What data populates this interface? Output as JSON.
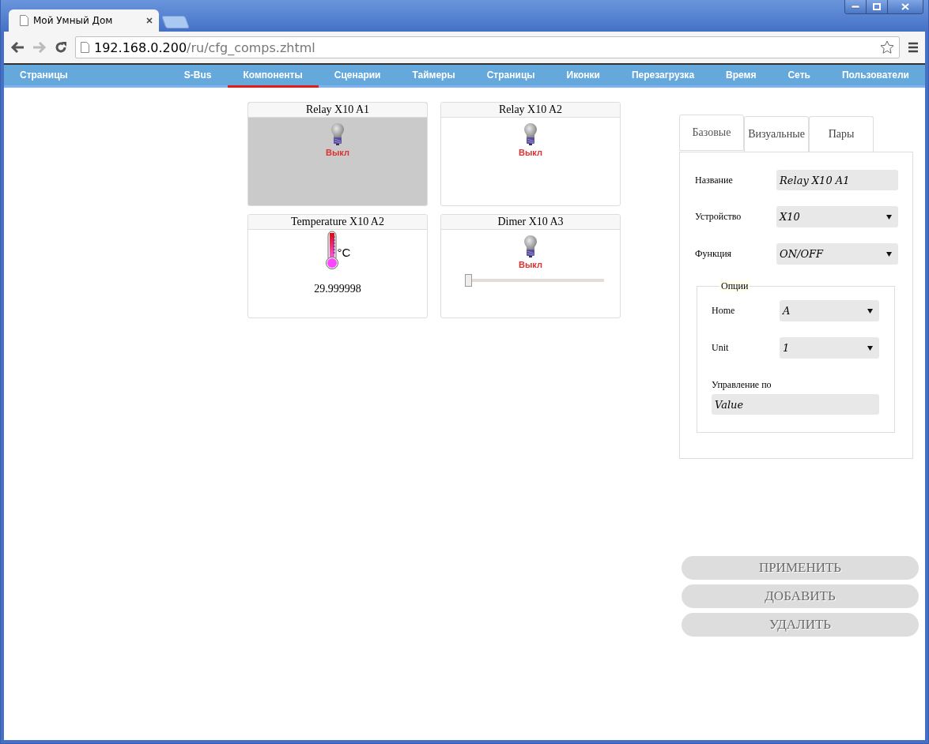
{
  "browser": {
    "tab_title": "Мой Умный Дом",
    "url_host": "192.168.0.200",
    "url_path": "/ru/cfg_comps.zhtml"
  },
  "nav": {
    "items": [
      {
        "label": "Страницы",
        "selected": false
      },
      {
        "label": "S-Bus",
        "selected": false
      },
      {
        "label": "Компоненты",
        "selected": true
      },
      {
        "label": "Сценарии",
        "selected": false
      },
      {
        "label": "Таймеры",
        "selected": false
      },
      {
        "label": "Страницы",
        "selected": false
      },
      {
        "label": "Иконки",
        "selected": false
      },
      {
        "label": "Перезагрузка",
        "selected": false
      },
      {
        "label": "Время",
        "selected": false
      },
      {
        "label": "Сеть",
        "selected": false
      },
      {
        "label": "Пользователи",
        "selected": false
      }
    ]
  },
  "components": [
    {
      "kind": "relay",
      "title": "Relay X10 A1",
      "status": "Выкл",
      "selected": true
    },
    {
      "kind": "relay",
      "title": "Relay X10 A2",
      "status": "Выкл",
      "selected": false
    },
    {
      "kind": "temperature",
      "title": "Temperature X10 A2",
      "unit": "°C",
      "value": "29.999998",
      "selected": false
    },
    {
      "kind": "dimmer",
      "title": "Dimer X10 A3",
      "status": "Выкл",
      "level": 0,
      "selected": false
    }
  ],
  "settings": {
    "tabs": [
      {
        "label": "Базовые",
        "selected": true
      },
      {
        "label": "Визуальные",
        "selected": false
      },
      {
        "label": "Пары",
        "selected": false
      }
    ],
    "fields": [
      {
        "kind": "input",
        "label": "Название",
        "value": "Relay X10 A1"
      },
      {
        "kind": "select",
        "label": "Устройство",
        "value": "X10"
      },
      {
        "kind": "select",
        "label": "Функция",
        "value": "ON/OFF"
      }
    ],
    "options": {
      "legend": "Опции",
      "fields": [
        {
          "kind": "select",
          "label": "Home",
          "value": "A"
        },
        {
          "kind": "select",
          "label": "Unit",
          "value": "1"
        },
        {
          "kind": "input_below",
          "label": "Управление по",
          "value": "Value"
        }
      ]
    }
  },
  "buttons": [
    "ПРИМЕНИТЬ",
    "ДОБАВИТЬ",
    "УДАЛИТЬ"
  ]
}
